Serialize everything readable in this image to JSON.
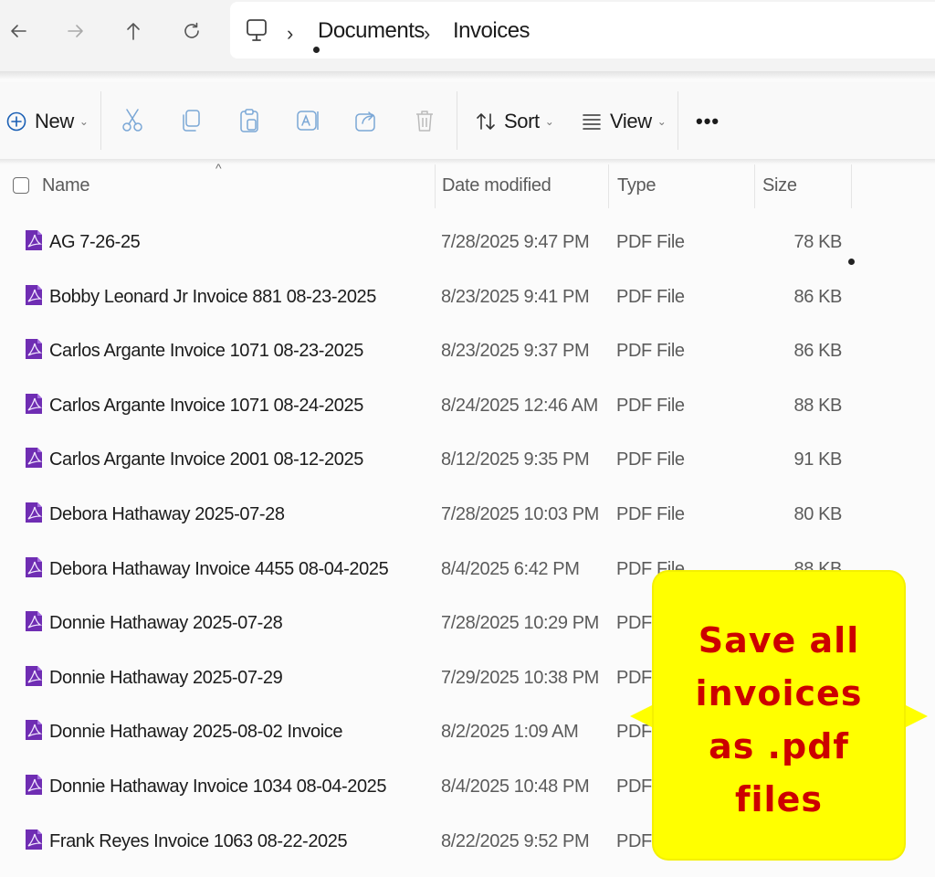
{
  "breadcrumb": {
    "items": [
      "Documents",
      "Invoices"
    ],
    "separator": "›"
  },
  "commandbar": {
    "new_label": "New",
    "sort_label": "Sort",
    "view_label": "View",
    "more_label": "•••"
  },
  "columns": {
    "name": "Name",
    "date": "Date modified",
    "type": "Type",
    "size": "Size"
  },
  "files": [
    {
      "name": "AG 7-26-25",
      "date": "7/28/2025 9:47 PM",
      "type": "PDF File",
      "size": "78 KB"
    },
    {
      "name": "Bobby Leonard Jr Invoice 881 08-23-2025",
      "date": "8/23/2025 9:41 PM",
      "type": "PDF File",
      "size": "86 KB"
    },
    {
      "name": "Carlos Argante Invoice 1071 08-23-2025",
      "date": "8/23/2025 9:37 PM",
      "type": "PDF File",
      "size": "86 KB"
    },
    {
      "name": "Carlos Argante Invoice 1071 08-24-2025",
      "date": "8/24/2025 12:46 AM",
      "type": "PDF File",
      "size": "88 KB"
    },
    {
      "name": "Carlos Argante Invoice 2001 08-12-2025",
      "date": "8/12/2025 9:35 PM",
      "type": "PDF File",
      "size": "91 KB"
    },
    {
      "name": "Debora Hathaway 2025-07-28",
      "date": "7/28/2025 10:03 PM",
      "type": "PDF File",
      "size": "80 KB"
    },
    {
      "name": "Debora Hathaway Invoice 4455 08-04-2025",
      "date": "8/4/2025 6:42 PM",
      "type": "PDF File",
      "size": "88 KB"
    },
    {
      "name": "Donnie Hathaway 2025-07-28",
      "date": "7/28/2025 10:29 PM",
      "type": "PDF File",
      "size": ""
    },
    {
      "name": "Donnie Hathaway 2025-07-29",
      "date": "7/29/2025 10:38 PM",
      "type": "PDF File",
      "size": ""
    },
    {
      "name": "Donnie Hathaway 2025-08-02 Invoice",
      "date": "8/2/2025 1:09 AM",
      "type": "PDF File",
      "size": ""
    },
    {
      "name": "Donnie Hathaway Invoice 1034 08-04-2025",
      "date": "8/4/2025 10:48 PM",
      "type": "PDF File",
      "size": ""
    },
    {
      "name": "Frank Reyes Invoice 1063 08-22-2025",
      "date": "8/22/2025 9:52 PM",
      "type": "PDF File",
      "size": ""
    }
  ],
  "callout": {
    "lines": [
      "Save all",
      "invoices",
      "as .pdf",
      "files"
    ]
  },
  "colors": {
    "accent_text": "#cc0000",
    "callout_bg": "#ffff00",
    "pdf_icon": "#7b2fbf"
  },
  "icons": {
    "back": "arrow-left-icon",
    "forward": "arrow-right-icon",
    "up": "arrow-up-icon",
    "refresh": "refresh-icon",
    "location": "computer-icon",
    "file": "pdf-file-icon"
  }
}
